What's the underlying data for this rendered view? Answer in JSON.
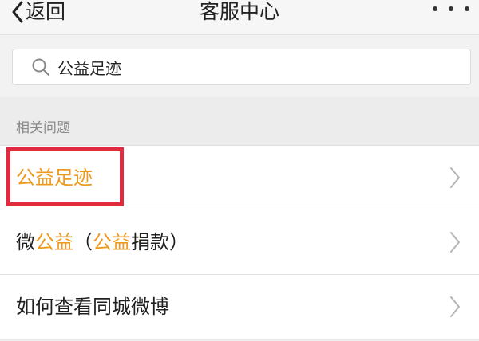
{
  "navbar": {
    "back_label": "返回",
    "title": "客服中心",
    "more_icon": "more-dots-icon"
  },
  "search": {
    "value": "公益足迹",
    "placeholder": "",
    "icon": "search-icon"
  },
  "section": {
    "label": "相关问题"
  },
  "list": {
    "items": [
      {
        "segments": [
          {
            "text": "公益足迹",
            "highlight": true
          }
        ],
        "annotated": true
      },
      {
        "segments": [
          {
            "text": "微",
            "highlight": false
          },
          {
            "text": "公益",
            "highlight": true
          },
          {
            "text": "（",
            "highlight": false
          },
          {
            "text": "公益",
            "highlight": true
          },
          {
            "text": "捐款）",
            "highlight": false
          }
        ],
        "annotated": false
      },
      {
        "segments": [
          {
            "text": "如何查看同城微博",
            "highlight": false
          }
        ],
        "annotated": false
      }
    ]
  },
  "colors": {
    "highlight_text": "#ee9a1e",
    "annotation_box": "#e02a3e",
    "background": "#ececec"
  }
}
